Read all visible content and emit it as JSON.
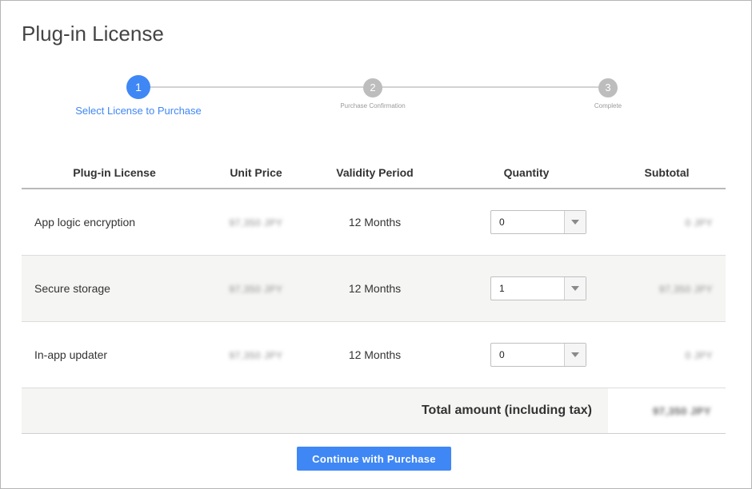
{
  "page": {
    "title": "Plug-in License"
  },
  "stepper": {
    "steps": [
      {
        "number": "1",
        "label": "Select License to Purchase",
        "active": true
      },
      {
        "number": "2",
        "label": "Purchase Confirmation",
        "active": false
      },
      {
        "number": "3",
        "label": "Complete",
        "active": false
      }
    ]
  },
  "table": {
    "headers": {
      "license": "Plug-in License",
      "unit_price": "Unit Price",
      "validity": "Validity Period",
      "quantity": "Quantity",
      "subtotal": "Subtotal"
    },
    "rows": [
      {
        "name": "App logic encryption",
        "unit_price": "97,350 JPY",
        "validity": "12 Months",
        "quantity": "0",
        "subtotal": "0 JPY"
      },
      {
        "name": "Secure storage",
        "unit_price": "97,350 JPY",
        "validity": "12 Months",
        "quantity": "1",
        "subtotal": "97,350 JPY"
      },
      {
        "name": "In-app updater",
        "unit_price": "97,350 JPY",
        "validity": "12 Months",
        "quantity": "0",
        "subtotal": "0 JPY"
      }
    ],
    "total_label": "Total amount (including tax)",
    "total_value": "97,350 JPY"
  },
  "actions": {
    "continue_label": "Continue with Purchase"
  },
  "colors": {
    "accent": "#3f87f5",
    "inactive_step": "#bdbdbd",
    "row_alt": "#f5f5f3"
  }
}
